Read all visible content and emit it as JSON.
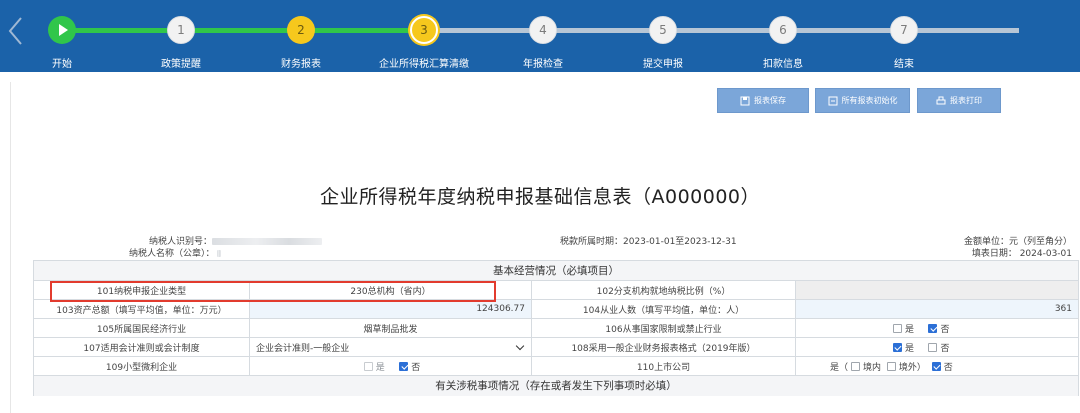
{
  "steps": [
    {
      "label": "开始",
      "num": "",
      "state": "start"
    },
    {
      "label": "政策提醒",
      "num": "1",
      "state": "todo"
    },
    {
      "label": "财务报表",
      "num": "2",
      "state": "done"
    },
    {
      "label": "企业所得税汇算清缴",
      "num": "3",
      "state": "current"
    },
    {
      "label": "年报检查",
      "num": "4",
      "state": "todo"
    },
    {
      "label": "提交申报",
      "num": "5",
      "state": "todo"
    },
    {
      "label": "扣款信息",
      "num": "6",
      "state": "todo"
    },
    {
      "label": "结束",
      "num": "7",
      "state": "todo"
    }
  ],
  "toolbar": {
    "save": "报表保存",
    "init_all": "所有报表初始化",
    "print": "报表打印"
  },
  "form": {
    "title": "企业所得税年度纳税申报基础信息表（A000000）",
    "taxpayer_id_label": "纳税人识别号：",
    "taxpayer_name_label": "纳税人名称（公章）：",
    "period": "税款所属时期：2023-01-01至2023-12-31",
    "unit": "金额单位：元（列至角分）",
    "fill_date": "填表日期： 2024-03-01"
  },
  "sections": {
    "basic": "基本经营情况（必填项目）",
    "tax_matters": "有关涉税事项情况（存在或者发生下列事项时必填）"
  },
  "rows": {
    "r101_label": "101纳税申报企业类型",
    "r101_value": "230总机构（省内）",
    "r102_label": "102分支机构就地纳税比例（%）",
    "r103_label": "103资产总额（填写平均值，单位：万元）",
    "r103_value": "124306.77",
    "r104_label": "104从业人数（填写平均值，单位：人）",
    "r104_value": "361",
    "r105_label": "105所属国民经济行业",
    "r105_value": "烟草制品批发",
    "r106_label": "106从事国家限制或禁止行业",
    "r107_label": "107适用会计准则或会计制度",
    "r107_value": "企业会计准则-一般企业",
    "r108_label": "108采用一般企业财务报表格式（2019年版）",
    "r109_label": "109小型微利企业",
    "r110_label": "110上市公司"
  },
  "options": {
    "yes": "是",
    "no": "否",
    "yes_paren": "是（",
    "domestic": "境内",
    "overseas": "境外）",
    "no2": "否"
  }
}
